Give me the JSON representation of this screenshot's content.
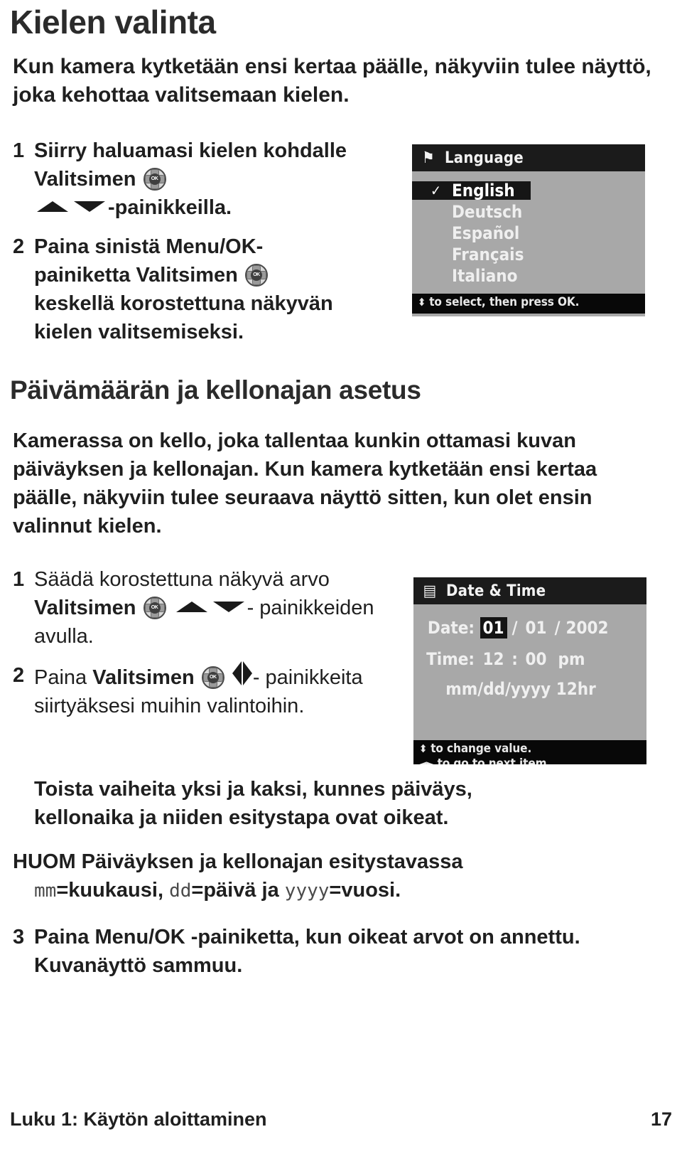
{
  "page": {
    "heading1": "Kielen valinta",
    "intro": "Kun kamera kytketään ensi kertaa päälle, näkyviin tulee näyttö, joka kehottaa valitsemaan kielen.",
    "heading2": "Päivämäärän ja kellonajan asetus",
    "paragraph1": "Kamerassa on kello, joka tallentaa kunkin ottamasi kuvan päiväyksen ja kellonajan. Kun kamera kytketään ensi kertaa päälle, näkyviin tulee seuraava näyttö sitten, kun olet ensin valinnut kielen.",
    "paragraph2": "Toista vaiheita yksi ja kaksi, kunnes päiväys, kellonaika ja niiden esitystapa ovat oikeat."
  },
  "steps_language": [
    {
      "num": "1",
      "part1": "Siirry haluamasi kielen kohdalle ",
      "bold1": "Valitsimen",
      "icon1": "dpad-icon",
      "icon2": "triangle-up-icon",
      "icon3": "triangle-down-icon",
      "part2": "-painikkeilla."
    },
    {
      "num": "2",
      "part1": "Paina sinistä ",
      "bold1": "Menu/OK-",
      "part2": "painiketta ",
      "bold2": "Valitsimen",
      "icon1": "dpad-icon",
      "part3": "keskellä korostettuna näkyvän kielen valitsemiseksi."
    }
  ],
  "steps_datetime": [
    {
      "num": "1",
      "part1": "Säädä korostettuna näkyvä arvo ",
      "bold1": "Valitsimen",
      "icon1": "dpad-icon",
      "icon2": "triangle-up-icon",
      "icon3": "triangle-down-icon",
      "part2": "- painikkeiden avulla."
    },
    {
      "num": "2",
      "part1": "Paina ",
      "bold1": "Valitsimen",
      "icon1": "dpad-icon",
      "icon2": "triangle-left-icon",
      "icon3": "triangle-right-icon",
      "part2": "- painikkeita siirtyäksesi muihin valintoihin."
    },
    {
      "num": "3",
      "part1": "Paina ",
      "bold1": "Menu/OK",
      "part2": " -painiketta, kun oikeat arvot on annettu. Kuvanäyttö sammuu."
    }
  ],
  "note": {
    "label": "HUOM",
    "text_before": " Päiväyksen ja kellonajan esitystavassa ",
    "tag_mm": "mm",
    "after_mm": "=kuukausi, ",
    "tag_dd": "dd",
    "after_dd": "=päivä ja ",
    "tag_yyyy": "yyyy",
    "after_yyyy": "=vuosi."
  },
  "lcd_language": {
    "icon": "flag-icon",
    "icon_glyph": "⚑",
    "title": "Language",
    "items": [
      {
        "label": "English",
        "selected": true,
        "check": "✓"
      },
      {
        "label": "Deutsch",
        "selected": false,
        "check": ""
      },
      {
        "label": "Español",
        "selected": false,
        "check": ""
      },
      {
        "label": "Français",
        "selected": false,
        "check": ""
      },
      {
        "label": "Italiano",
        "selected": false,
        "check": ""
      }
    ],
    "hint_arrow": "⬍",
    "hint": "to select, then press OK."
  },
  "lcd_datetime": {
    "icon": "clock-calendar-icon",
    "icon_glyph": "▤",
    "title": "Date & Time",
    "date_label": "Date:",
    "date_month": "01",
    "date_day": "01",
    "date_year": "2002",
    "date_sep": "/",
    "time_label": "Time:",
    "time_hour": "12",
    "time_minute": "00",
    "time_sep": ":",
    "time_meridiem": "pm",
    "format_line": "mm/dd/yyyy 12hr",
    "hint_arrow_1": "⬍",
    "hint_1": "to change value.",
    "hint_arrow_2": "◄►",
    "hint_2": "to go to next item."
  },
  "footer": {
    "chapter": "Luku 1: Käytön aloittaminen",
    "page_number": "17"
  }
}
